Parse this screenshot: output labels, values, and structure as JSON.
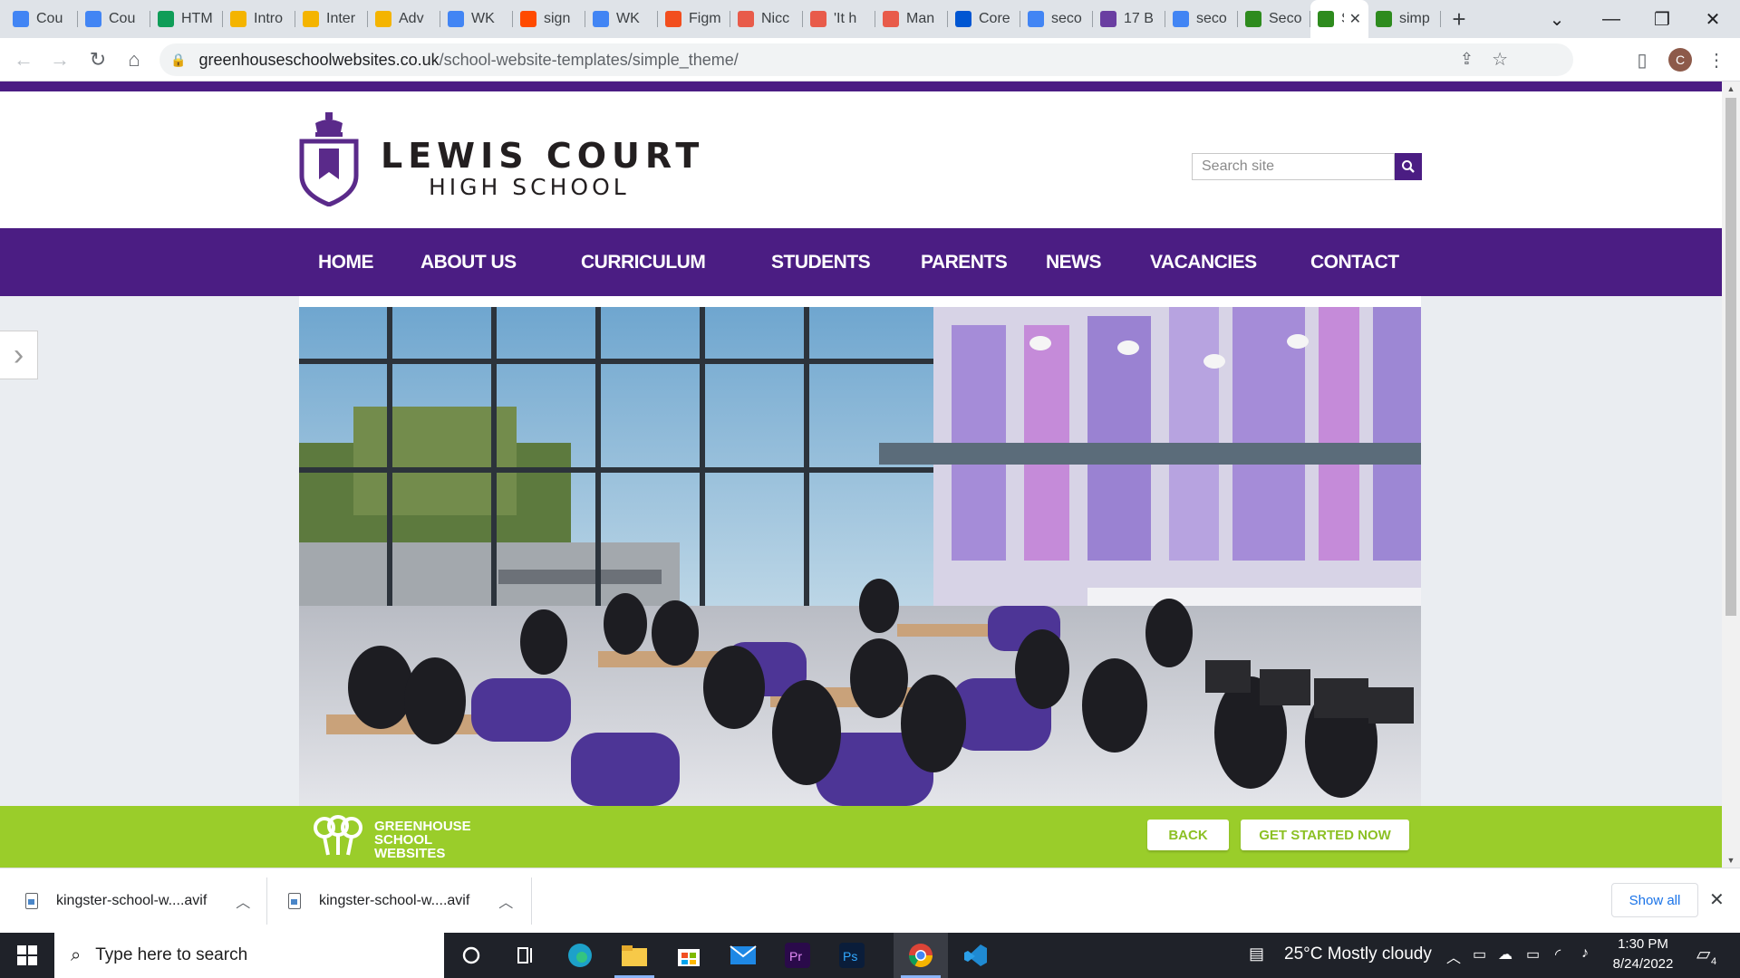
{
  "browser": {
    "tabs": [
      {
        "title": "Cou",
        "icon": "docs-icon",
        "color": "#4285f4"
      },
      {
        "title": "Cou",
        "icon": "docs-icon",
        "color": "#4285f4"
      },
      {
        "title": "HTM",
        "icon": "drive-icon",
        "color": "#0f9d58"
      },
      {
        "title": "Intro",
        "icon": "slides-icon",
        "color": "#f4b400"
      },
      {
        "title": "Inter",
        "icon": "slides-icon",
        "color": "#f4b400"
      },
      {
        "title": "Adv",
        "icon": "slides-icon",
        "color": "#f4b400"
      },
      {
        "title": "WK",
        "icon": "docs-icon",
        "color": "#4285f4"
      },
      {
        "title": "sign",
        "icon": "zapier-icon",
        "color": "#ff4a00"
      },
      {
        "title": "WK",
        "icon": "docs-icon",
        "color": "#4285f4"
      },
      {
        "title": "Figm",
        "icon": "figma-icon",
        "color": "#f24e1e"
      },
      {
        "title": "Nicc",
        "icon": "monitor-icon",
        "color": "#e85b4a"
      },
      {
        "title": "'It h",
        "icon": "monitor-icon",
        "color": "#e85b4a"
      },
      {
        "title": "Man",
        "icon": "monitor-icon",
        "color": "#e85b4a"
      },
      {
        "title": "Core",
        "icon": "coursera-icon",
        "color": "#0056d2"
      },
      {
        "title": "seco",
        "icon": "google-icon",
        "color": "#4285f4"
      },
      {
        "title": "17 B",
        "icon": "colorlib-icon",
        "color": "#6a3ea1"
      },
      {
        "title": "seco",
        "icon": "google-icon",
        "color": "#4285f4"
      },
      {
        "title": "Seco",
        "icon": "greenhouse-icon",
        "color": "#2e8b1e"
      },
      {
        "title": "S",
        "icon": "greenhouse-icon",
        "color": "#2e8b1e"
      },
      {
        "title": "simp",
        "icon": "greenhouse-icon",
        "color": "#2e8b1e"
      }
    ],
    "url_host": "greenhouseschoolwebsites.co.uk",
    "url_path": "/school-website-templates/simple_theme/",
    "profile_initial": "C"
  },
  "site": {
    "school_name_line1": "LEWIS COURT",
    "school_name_line2": "HIGH SCHOOL",
    "search_placeholder": "Search site",
    "nav": [
      "HOME",
      "ABOUT US",
      "CURRICULUM",
      "STUDENTS",
      "PARENTS",
      "NEWS",
      "VACANCIES",
      "CONTACT"
    ],
    "brand_color": "#4b1d83",
    "promo": {
      "brand_line1": "GREENHOUSE",
      "brand_line2": "SCHOOL",
      "brand_line3": "WEBSITES",
      "back_label": "BACK",
      "cta_label": "GET STARTED NOW",
      "color": "#9acd2a"
    }
  },
  "downloads": {
    "items": [
      "kingster-school-w....avif",
      "kingster-school-w....avif"
    ],
    "show_all": "Show all"
  },
  "taskbar": {
    "search_placeholder": "Type here to search",
    "weather": "25°C  Mostly cloudy",
    "time": "1:30 PM",
    "date": "8/24/2022",
    "notifications": "4"
  }
}
